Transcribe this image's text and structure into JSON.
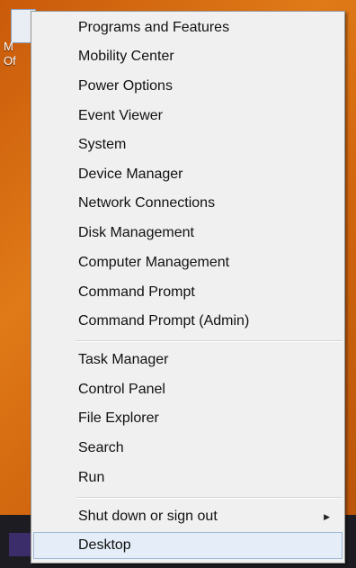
{
  "desktop": {
    "icon_label_lines": [
      "M",
      "Of"
    ]
  },
  "menu": {
    "group1": [
      "Programs and Features",
      "Mobility Center",
      "Power Options",
      "Event Viewer",
      "System",
      "Device Manager",
      "Network Connections",
      "Disk Management",
      "Computer Management",
      "Command Prompt",
      "Command Prompt (Admin)"
    ],
    "group2": [
      "Task Manager",
      "Control Panel",
      "File Explorer",
      "Search",
      "Run"
    ],
    "group3": [
      "Shut down or sign out",
      "Desktop"
    ],
    "submenu_arrow_icon": "chevron-right-icon",
    "highlighted_item": "Desktop"
  },
  "colors": {
    "menu_background": "#f0f0f0",
    "highlight_background": "#e5eef8",
    "highlight_border": "#9cb8d8",
    "desktop_orange": "#d96a10"
  }
}
